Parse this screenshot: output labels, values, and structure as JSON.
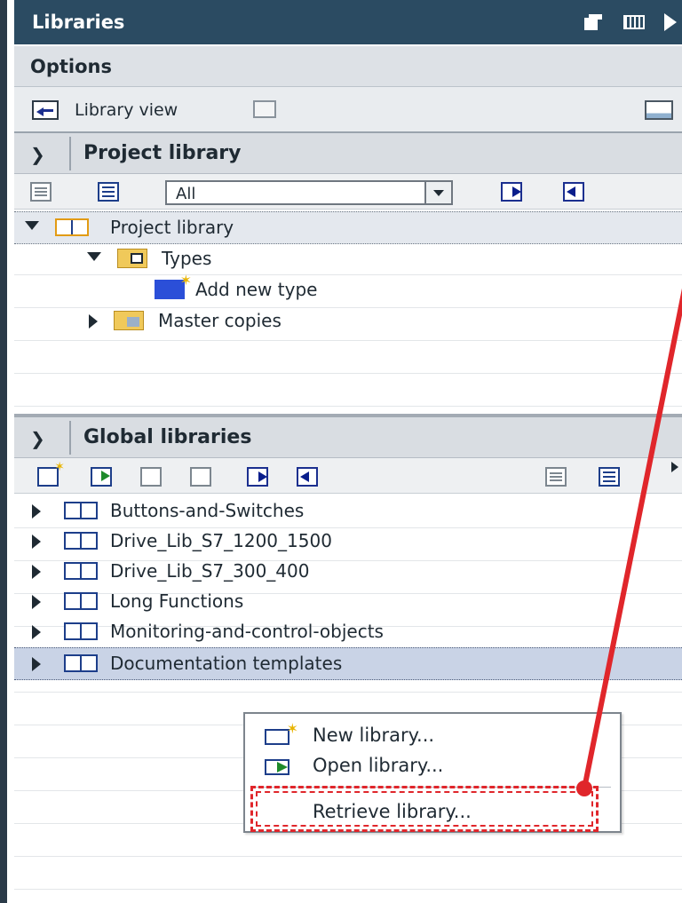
{
  "header": {
    "title": "Libraries"
  },
  "options": {
    "label": "Options"
  },
  "library_view": {
    "label": "Library view"
  },
  "project_library": {
    "section_label": "Project library",
    "filter_value": "All",
    "tree": [
      {
        "label": "Project library",
        "level": 0,
        "expanded": true,
        "icon": "library-icon"
      },
      {
        "label": "Types",
        "level": 1,
        "expanded": true,
        "icon": "types-folder-icon"
      },
      {
        "label": "Add new type",
        "level": 2,
        "icon": "add-type-icon"
      },
      {
        "label": "Master copies",
        "level": 1,
        "expanded": false,
        "icon": "folder-icon"
      }
    ]
  },
  "global_libraries": {
    "section_label": "Global libraries",
    "items": [
      "Buttons-and-Switches",
      "Drive_Lib_S7_1200_1500",
      "Drive_Lib_S7_300_400",
      "Long Functions",
      "Monitoring-and-control-objects",
      "Documentation templates"
    ],
    "selected_item": "Documentation templates"
  },
  "context_menu": {
    "items": [
      "New library...",
      "Open library...",
      "Retrieve library..."
    ],
    "highlighted": "Retrieve library..."
  },
  "colors": {
    "title_bar": "#2b4b62",
    "annotation_red": "#e0262b",
    "selection": "#c9d3e6"
  }
}
